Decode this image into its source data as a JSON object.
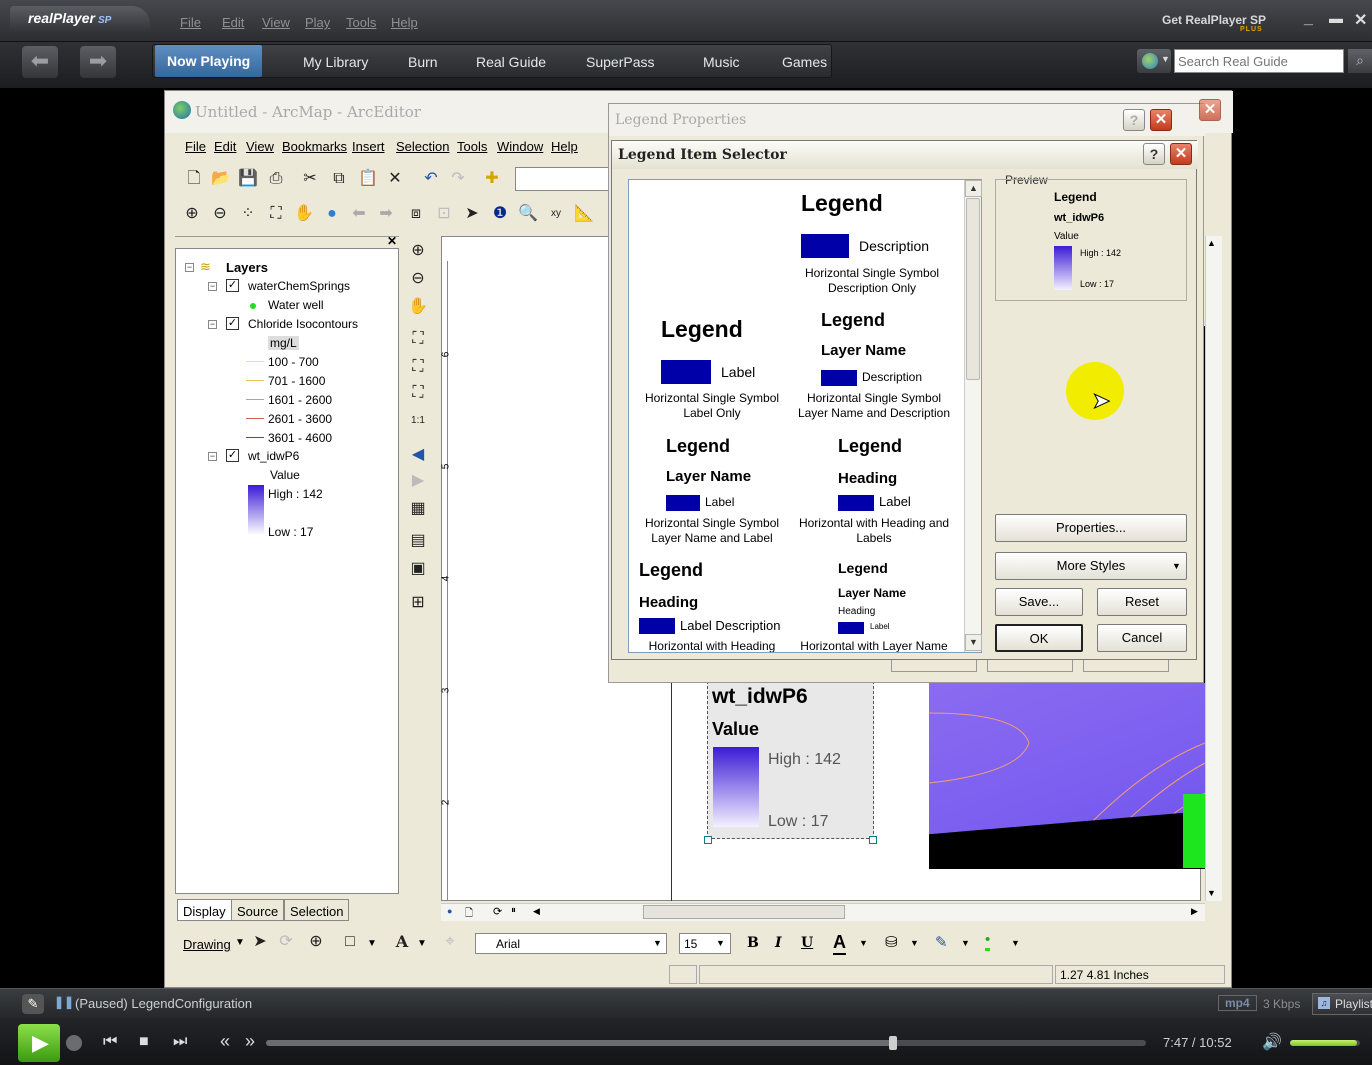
{
  "player": {
    "logo": "realPlayer",
    "logo_sp": "SP",
    "menus": [
      "File",
      "Edit",
      "View",
      "Play",
      "Tools",
      "Help"
    ],
    "get_sp": "Get RealPlayer SP",
    "plus": "PLUS",
    "tabs": [
      "Now Playing",
      "My Library",
      "Burn",
      "Real Guide",
      "SuperPass",
      "Music",
      "Games"
    ],
    "search_placeholder": "Search Real Guide",
    "status_text": "(Paused) LegendConfiguration",
    "format": "mp4",
    "bitrate": "3 Kbps",
    "playlist": "Playlist",
    "time": "7:47 / 10:52",
    "progress_fraction": 0.713,
    "volume_fraction": 0.95
  },
  "arcmap": {
    "title": "Untitled - ArcMap - ArcEditor",
    "menus": [
      "File",
      "Edit",
      "View",
      "Bookmarks",
      "Insert",
      "Selection",
      "Tools",
      "Window",
      "Help"
    ],
    "toc": {
      "root": "Layers",
      "layers": [
        {
          "name": "waterChemSprings",
          "items": [
            "Water well"
          ]
        },
        {
          "name": "Chloride Isocontours",
          "unit": "mg/L",
          "items": [
            "100 - 700",
            "701 - 1600",
            "1601 - 2600",
            "2601 - 3600",
            "3601 - 4600"
          ]
        },
        {
          "name": "wt_idwP6",
          "field": "Value",
          "high": "High : 142",
          "low": "Low : 17"
        }
      ],
      "tabs": [
        "Display",
        "Source",
        "Selection"
      ]
    },
    "ruler_labels": [
      "6",
      "5",
      "4",
      "3",
      "2"
    ],
    "legend_on_page": {
      "title": "wt_idwP6",
      "subtitle": "Value",
      "high": "High : 142",
      "low": "Low : 17"
    },
    "drawing": {
      "label": "Drawing",
      "font": "Arial",
      "size": "15",
      "bold": "B",
      "italic": "I",
      "underline": "U",
      "font_color": "A"
    },
    "status": {
      "coords": "1.27  4.81 Inches"
    }
  },
  "legend_properties": {
    "title": "Legend Properties"
  },
  "legend_item_selector": {
    "title": "Legend Item Selector",
    "styles": [
      {
        "legend": "Legend",
        "label": "Description",
        "caption": [
          "Horizontal Single Symbol",
          "Description Only"
        ]
      },
      {
        "legend": "Legend",
        "label": "Label",
        "caption": [
          "Horizontal Single Symbol",
          "Label Only"
        ]
      },
      {
        "legend": "Legend",
        "layer": "Layer Name",
        "label": "Description",
        "caption": [
          "Horizontal Single Symbol",
          "Layer Name and Description"
        ]
      },
      {
        "legend": "Legend",
        "layer": "Layer Name",
        "label": "Label",
        "caption": [
          "Horizontal Single Symbol",
          "Layer Name and Label"
        ]
      },
      {
        "legend": "Legend",
        "heading": "Heading",
        "label": "Label",
        "caption": [
          "Horizontal with Heading and",
          "Labels"
        ]
      },
      {
        "legend": "Legend",
        "heading": "Heading",
        "label": "Label  Description",
        "caption": [
          "Horizontal with Heading"
        ]
      },
      {
        "legend": "Legend",
        "layer": "Layer Name",
        "heading": "Heading",
        "label": "Label",
        "caption": [
          "Horizontal with Layer Name"
        ]
      }
    ],
    "preview": {
      "label": "Preview",
      "legend": "Legend",
      "layer": "wt_idwP6",
      "field": "Value",
      "high": "High : 142",
      "low": "Low : 17"
    },
    "buttons": {
      "properties": "Properties...",
      "more_styles": "More Styles",
      "save": "Save...",
      "reset": "Reset",
      "ok": "OK",
      "cancel": "Cancel"
    }
  },
  "colors": {
    "accent_blue": "#35679c",
    "swatch": "#0000a8",
    "cursor_highlight": "#f2ec00"
  }
}
